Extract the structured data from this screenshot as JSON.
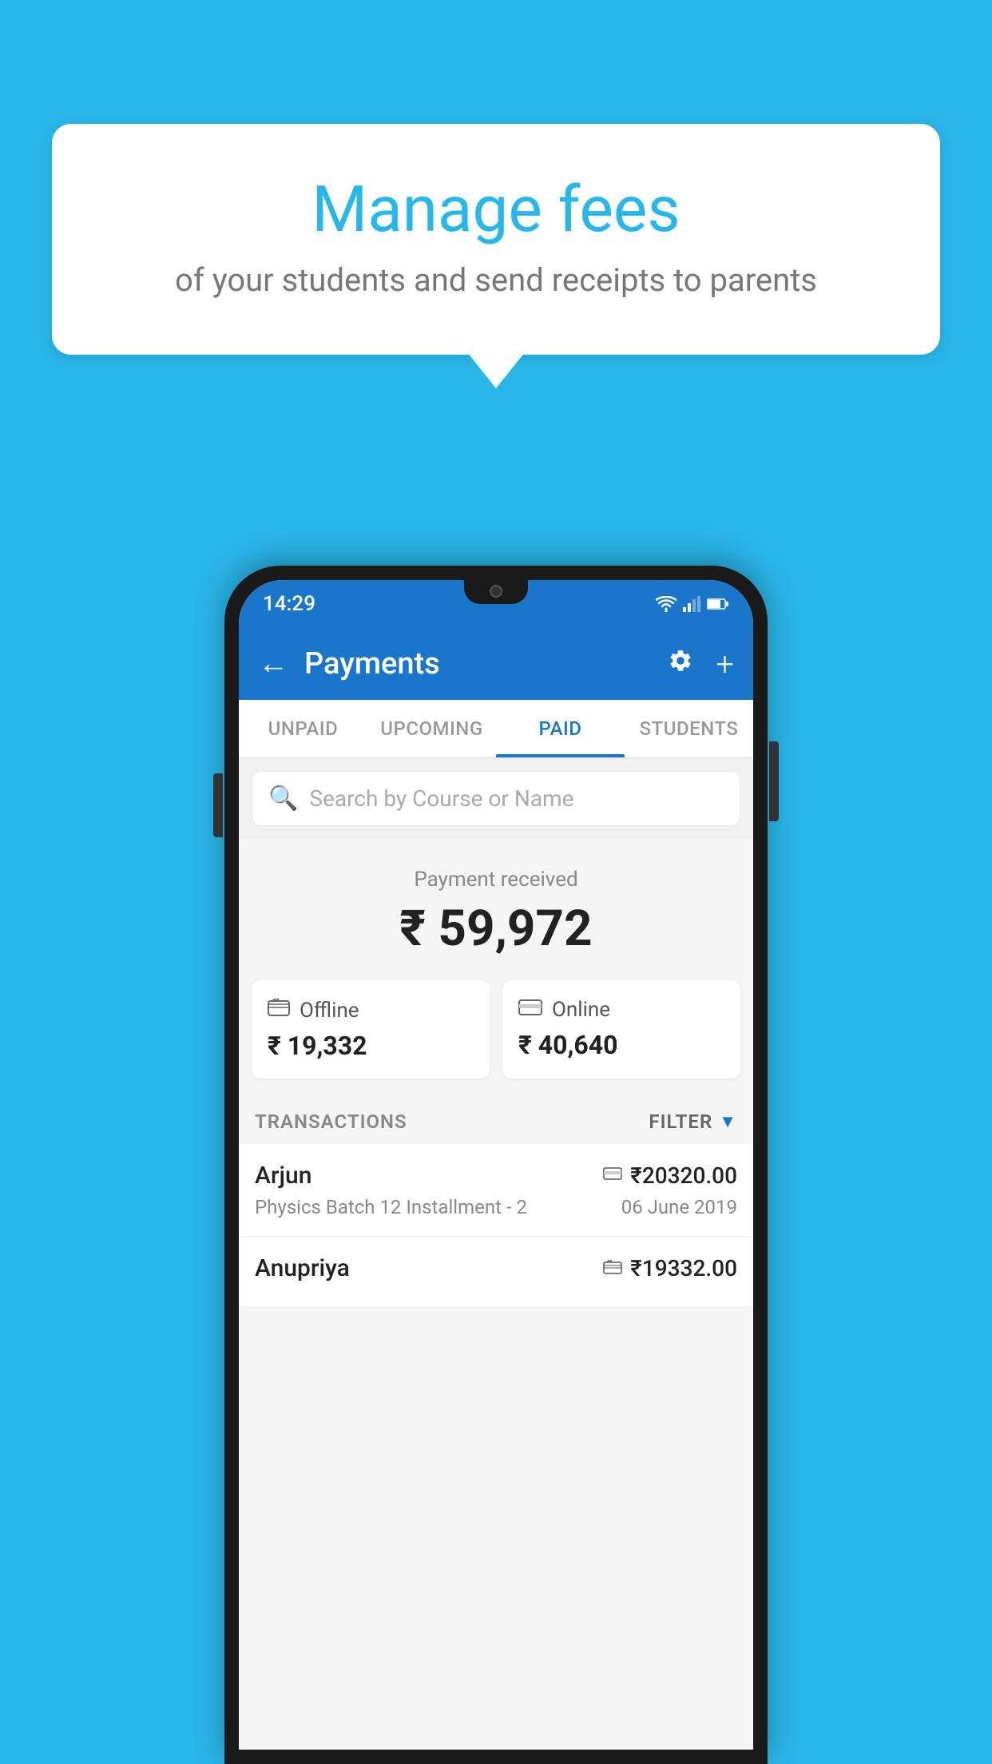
{
  "page": {
    "background_color": "#29b6e8"
  },
  "speech_bubble": {
    "title": "Manage fees",
    "subtitle": "of your students and send receipts to parents"
  },
  "status_bar": {
    "time": "14:29"
  },
  "app_bar": {
    "title": "Payments",
    "back_icon": "←",
    "settings_icon": "⚙",
    "add_icon": "+"
  },
  "tabs": [
    {
      "id": "unpaid",
      "label": "UNPAID",
      "active": false
    },
    {
      "id": "upcoming",
      "label": "UPCOMING",
      "active": false
    },
    {
      "id": "paid",
      "label": "PAID",
      "active": true
    },
    {
      "id": "students",
      "label": "STUDENTS",
      "active": false
    }
  ],
  "search": {
    "placeholder": "Search by Course or Name"
  },
  "payment_summary": {
    "label": "Payment received",
    "amount": "₹ 59,972"
  },
  "payment_cards": [
    {
      "id": "offline",
      "icon": "💳",
      "label": "Offline",
      "amount": "₹ 19,332"
    },
    {
      "id": "online",
      "icon": "💳",
      "label": "Online",
      "amount": "₹ 40,640"
    }
  ],
  "transactions": {
    "header": "TRANSACTIONS",
    "filter_label": "FILTER",
    "items": [
      {
        "name": "Arjun",
        "payment_mode": "online",
        "amount": "₹20320.00",
        "course": "Physics Batch 12 Installment - 2",
        "date": "06 June 2019"
      },
      {
        "name": "Anupriya",
        "payment_mode": "offline",
        "amount": "₹19332.00",
        "course": "",
        "date": ""
      }
    ]
  }
}
